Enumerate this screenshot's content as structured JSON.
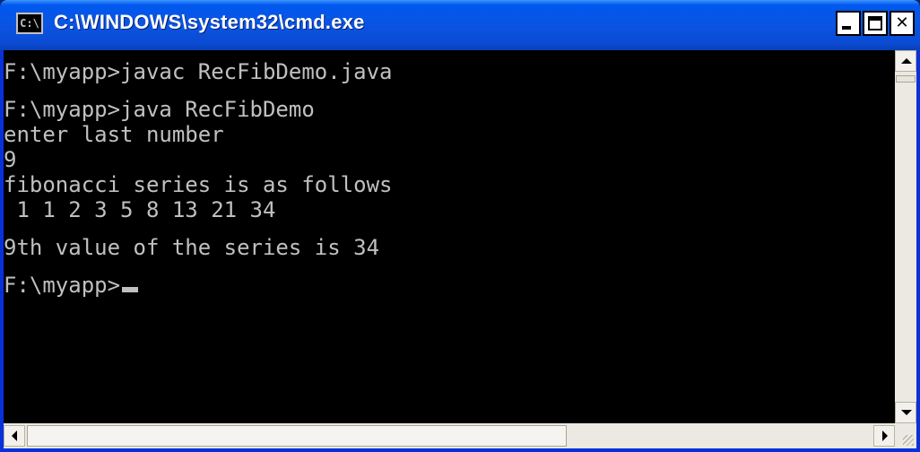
{
  "window": {
    "title": "C:\\WINDOWS\\system32\\cmd.exe",
    "icon": "console-app-icon",
    "icon_text": "C:\\"
  },
  "controls": {
    "minimize": "minimize-icon",
    "maximize": "maximize-icon",
    "close": "close-icon"
  },
  "console": {
    "lines": [
      "",
      "F:\\myapp>javac RecFibDemo.java",
      "",
      "F:\\myapp>java RecFibDemo",
      "enter last number",
      "9",
      "fibonacci series is as follows",
      " 1 1 2 3 5 8 13 21 34",
      "",
      "9th value of the series is 34",
      "",
      "F:\\myapp>"
    ]
  },
  "colors": {
    "console_background": "#000000",
    "console_text": "#c0c0c0",
    "titlebar": "#0a54e3"
  }
}
